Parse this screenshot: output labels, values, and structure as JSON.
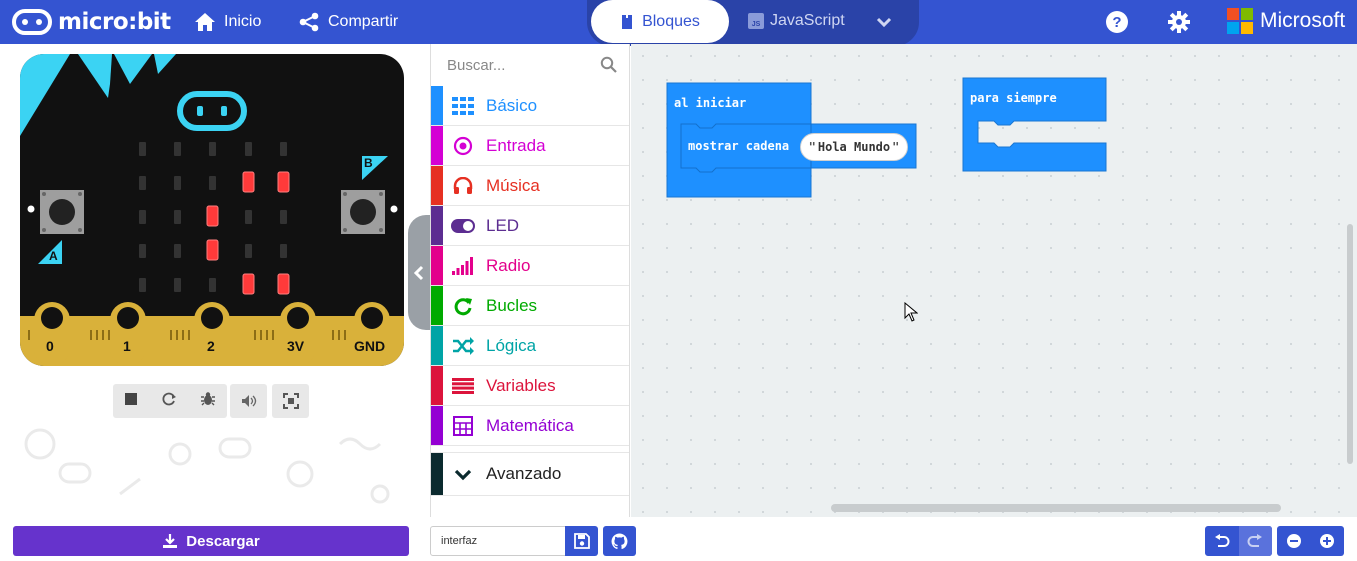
{
  "header": {
    "logo_text": "micro:bit",
    "home_label": "Inicio",
    "share_label": "Compartir",
    "tab_blocks": "Bloques",
    "tab_javascript": "JavaScript",
    "brand": "Microsoft",
    "colors": {
      "bar": "#3454d1"
    }
  },
  "simulator": {
    "pins": [
      "0",
      "1",
      "2",
      "3V",
      "GND"
    ],
    "button_a": "A",
    "button_b": "B",
    "controls": [
      "stop-icon",
      "restart-icon",
      "debug-icon",
      "sound-icon",
      "fullscreen-icon"
    ]
  },
  "toolbox": {
    "search_placeholder": "Buscar...",
    "categories": [
      {
        "label": "Básico",
        "color": "#1e90ff",
        "icon": "grid-icon"
      },
      {
        "label": "Entrada",
        "color": "#d400d4",
        "icon": "target-icon"
      },
      {
        "label": "Música",
        "color": "#e63022",
        "icon": "headphones-icon"
      },
      {
        "label": "LED",
        "color": "#5c2d91",
        "icon": "toggle-icon"
      },
      {
        "label": "Radio",
        "color": "#e3008c",
        "icon": "signal-icon"
      },
      {
        "label": "Bucles",
        "color": "#00aa00",
        "icon": "refresh-icon"
      },
      {
        "label": "Lógica",
        "color": "#00a4a6",
        "icon": "shuffle-icon"
      },
      {
        "label": "Variables",
        "color": "#dc143c",
        "icon": "lines-icon"
      },
      {
        "label": "Matemática",
        "color": "#9400d3",
        "icon": "calculator-icon"
      }
    ],
    "advanced_label": "Avanzado"
  },
  "workspace": {
    "on_start_label": "al iniciar",
    "show_string_label": "mostrar cadena",
    "string_value": "Hola Mundo",
    "forever_label": "para siempre"
  },
  "footer": {
    "download_label": "Descargar",
    "project_name": "interfaz"
  }
}
